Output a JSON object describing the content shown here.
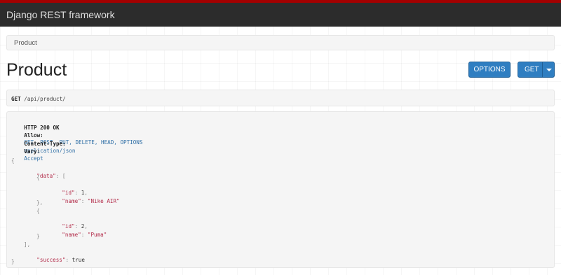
{
  "navbar": {
    "brand": "Django REST framework"
  },
  "breadcrumb": {
    "current": "Product"
  },
  "page": {
    "title": "Product"
  },
  "buttons": {
    "options_label": "OPTIONS",
    "get_label": "GET"
  },
  "request": {
    "method": "GET",
    "url": "/api/product/"
  },
  "response": {
    "status": "HTTP 200 OK",
    "headers": [
      {
        "name": "Allow:",
        "value": "GET, POST, PUT, DELETE, HEAD, OPTIONS"
      },
      {
        "name": "Content-Type:",
        "value": "application/json"
      },
      {
        "name": "Vary:",
        "value": "Accept"
      }
    ],
    "body": {
      "data_key": "\"data\"",
      "items": [
        {
          "id_key": "\"id\"",
          "id": "1",
          "name_key": "\"name\"",
          "name": "\"Nike AIR\""
        },
        {
          "id_key": "\"id\"",
          "id": "2",
          "name_key": "\"name\"",
          "name": "\"Puma\""
        }
      ],
      "success_key": "\"success\"",
      "success": "true"
    }
  }
}
